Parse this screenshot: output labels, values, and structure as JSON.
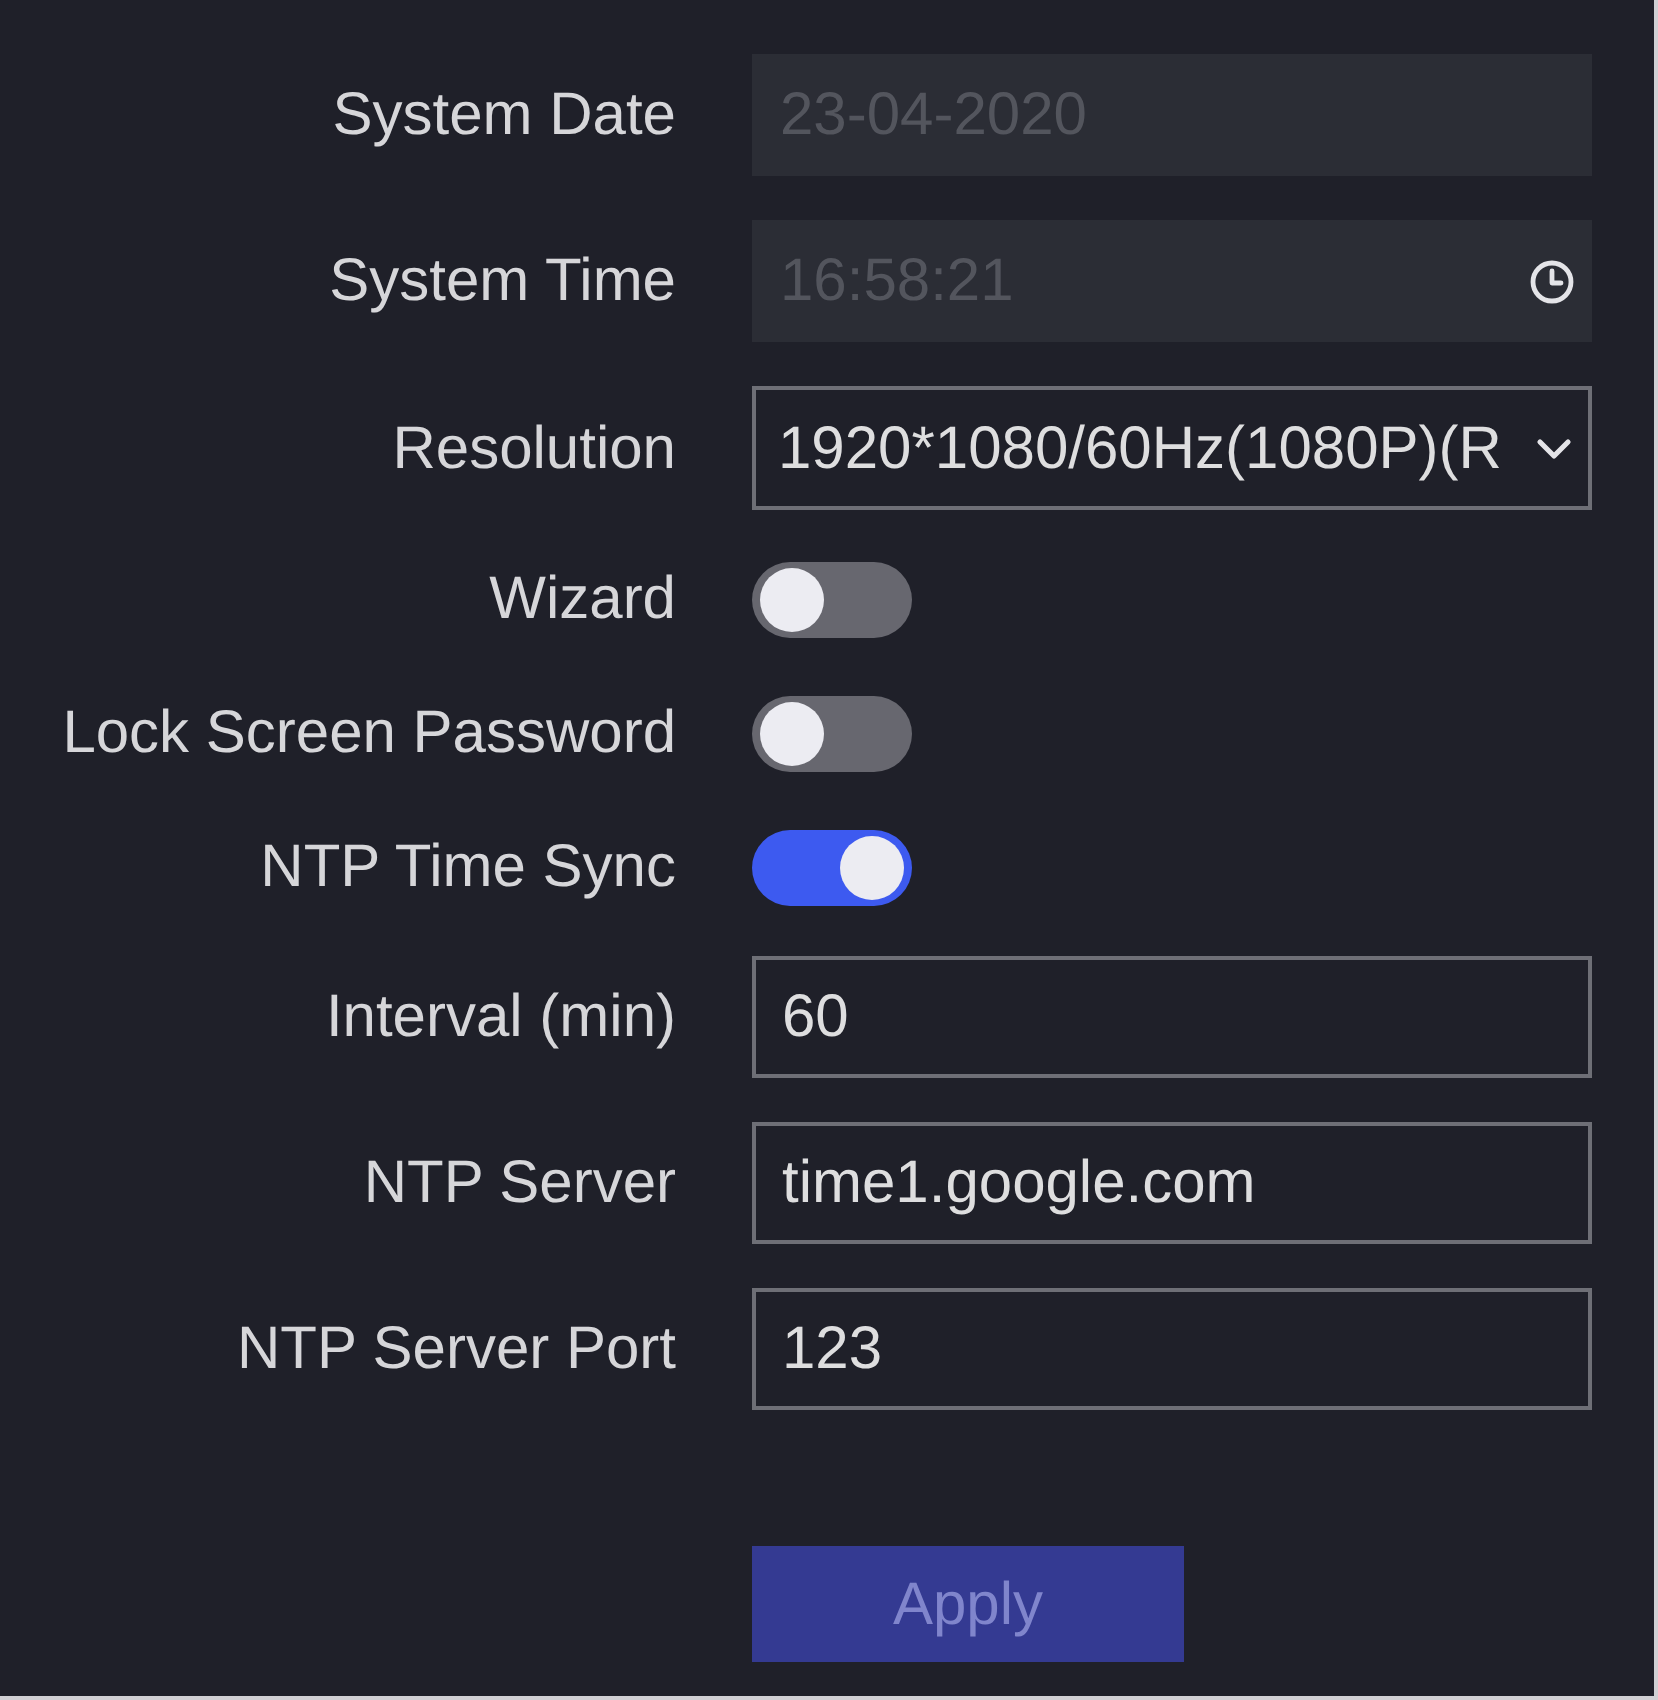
{
  "settings": [
    {
      "kind": "text",
      "label": "System Date",
      "value": "23-04-2020",
      "disabled": true
    },
    {
      "kind": "time",
      "label": "System Time",
      "value": "16:58:21",
      "disabled": true
    },
    {
      "kind": "select",
      "label": "Resolution",
      "value": "1920*1080/60Hz(1080P)(R",
      "disabled": false
    },
    {
      "kind": "toggle",
      "label": "Wizard",
      "on": false
    },
    {
      "kind": "toggle",
      "label": "Lock Screen Password",
      "on": false
    },
    {
      "kind": "toggle",
      "label": "NTP Time Sync",
      "on": true
    },
    {
      "kind": "text",
      "label": "Interval (min)",
      "value": "60",
      "disabled": false
    },
    {
      "kind": "text",
      "label": "NTP Server",
      "value": "time1.google.com",
      "disabled": false
    },
    {
      "kind": "text",
      "label": "NTP Server Port",
      "value": "123",
      "disabled": false
    }
  ],
  "apply_button": {
    "label": "Apply"
  }
}
